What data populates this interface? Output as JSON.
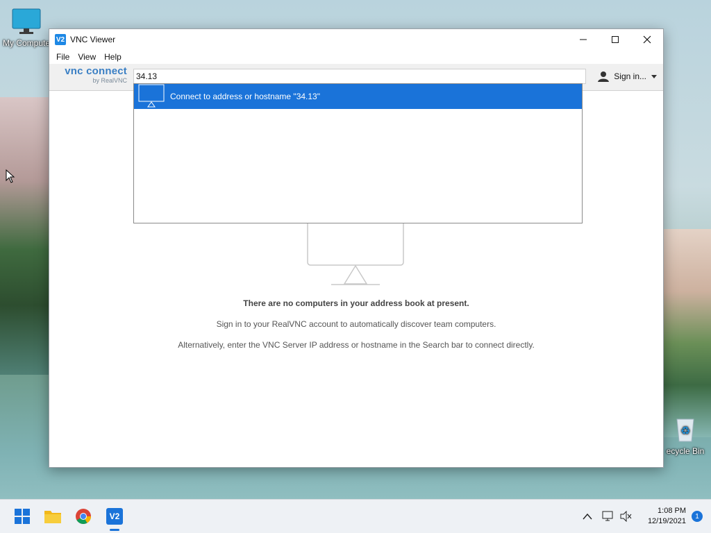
{
  "desktop": {
    "icons": [
      {
        "label": "My Compute"
      },
      {
        "label": "ecycle Bin"
      }
    ]
  },
  "window": {
    "title": "VNC Viewer",
    "menu": [
      "File",
      "View",
      "Help"
    ],
    "brand": {
      "main": "vnc connect",
      "sub": "by RealVNC"
    },
    "search": {
      "value": "34.13",
      "placeholder": ""
    },
    "signin_label": "Sign in...",
    "dropdown": {
      "item_label": "Connect to address or hostname \"34.13\""
    },
    "empty_state": {
      "heading": "There are no computers in your address book at present.",
      "line1": "Sign in to your RealVNC account to automatically discover team computers.",
      "line2": "Alternatively, enter the VNC Server IP address or hostname in the Search bar to connect directly."
    }
  },
  "taskbar": {
    "apps": [
      "start-icon",
      "file-explorer-icon",
      "chrome-icon",
      "vnc-viewer-icon"
    ],
    "time": "1:08 PM",
    "date": "12/19/2021",
    "notification_count": "1"
  },
  "colors": {
    "accent": "#1a73d9",
    "brand": "#3a7fc4"
  }
}
